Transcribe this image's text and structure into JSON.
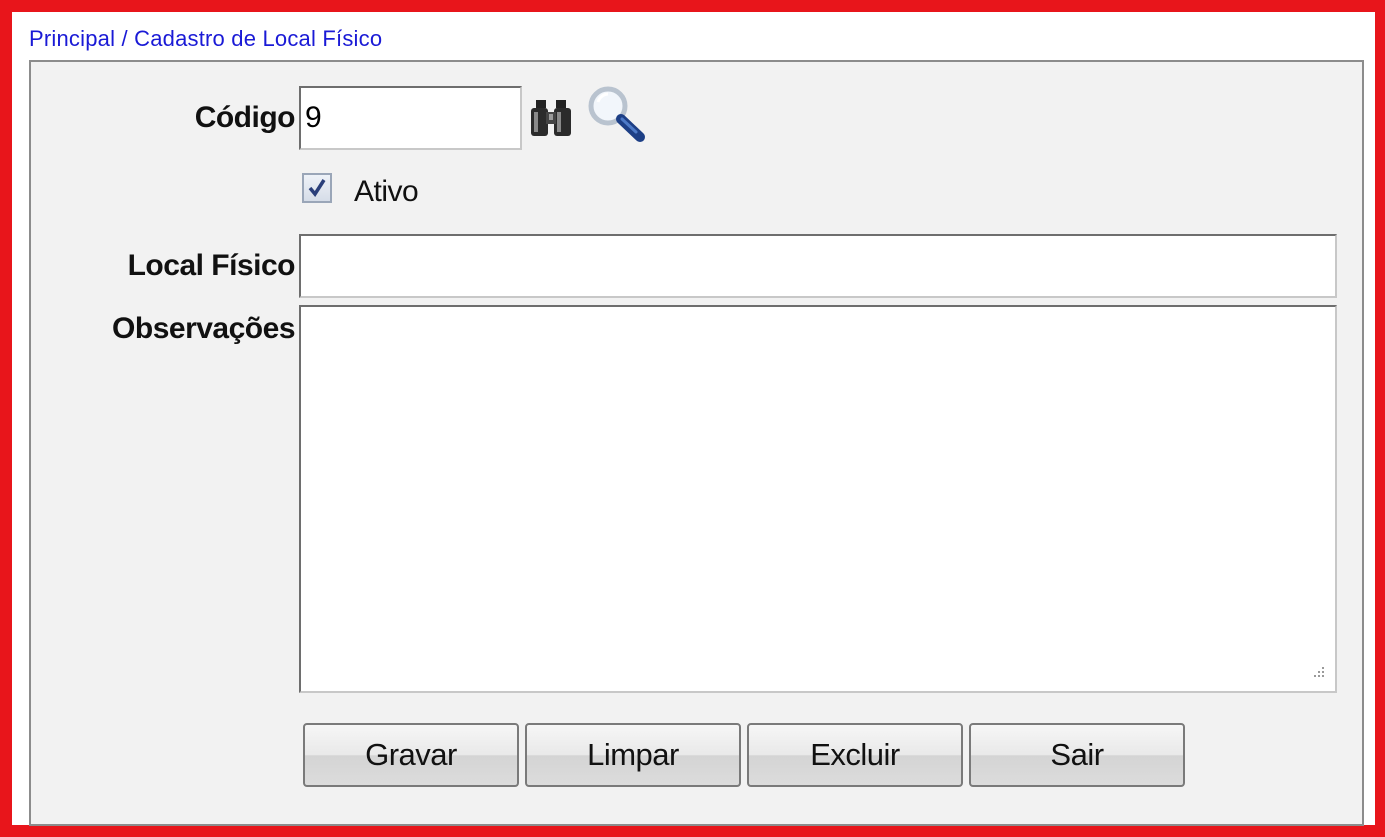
{
  "breadcrumb": "Principal / Cadastro de Local Físico",
  "form": {
    "codigo_label": "Código",
    "codigo_value": "9",
    "ativo_label": "Ativo",
    "ativo_checked": true,
    "local_label": "Local Físico",
    "local_value": "",
    "obs_label": "Observações",
    "obs_value": ""
  },
  "icons": {
    "binoculars": "binoculars-icon",
    "search": "magnifier-icon",
    "checkmark": "checkmark-icon"
  },
  "buttons": {
    "gravar": "Gravar",
    "limpar": "Limpar",
    "excluir": "Excluir",
    "sair": "Sair"
  },
  "colors": {
    "frame_border": "#e8151b",
    "breadcrumb_text": "#1a1ad6"
  }
}
